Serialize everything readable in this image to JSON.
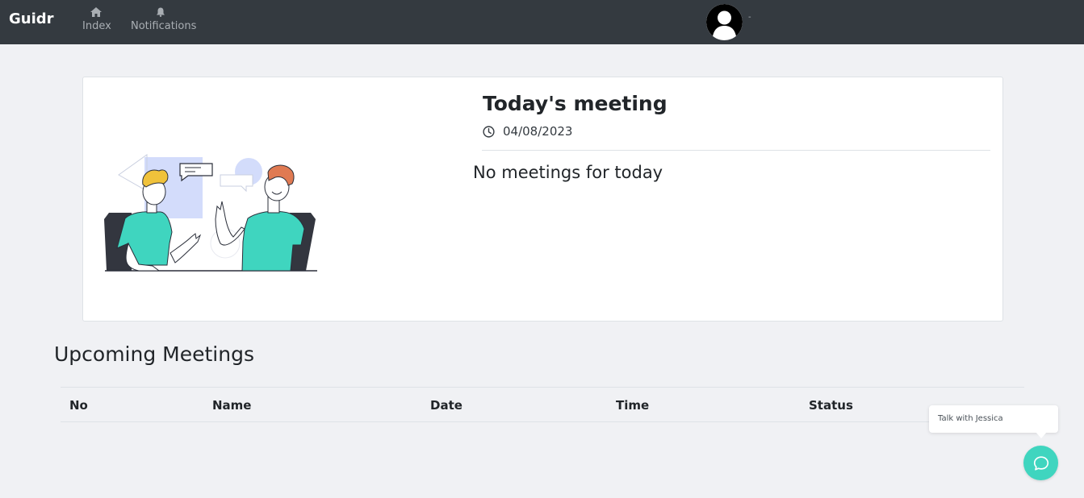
{
  "navbar": {
    "brand": "Guidr",
    "items": [
      {
        "label": "Index",
        "icon": "home-icon"
      },
      {
        "label": "Notifications",
        "icon": "bell-icon"
      }
    ],
    "avatar_caret": "-"
  },
  "today": {
    "title": "Today's meeting",
    "date": "04/08/2023",
    "empty_message": "No meetings for today",
    "illustration_colors": {
      "shirt": "#3fd5bf",
      "accent": "#d3dcfb",
      "hair_left": "#f0c23b",
      "hair_right": "#e07a52"
    }
  },
  "upcoming": {
    "title": "Upcoming Meetings",
    "columns": [
      "No",
      "Name",
      "Date",
      "Time",
      "Status"
    ]
  },
  "chat": {
    "tooltip": "Talk with Jessica",
    "button_color": "#3fd5bf"
  }
}
